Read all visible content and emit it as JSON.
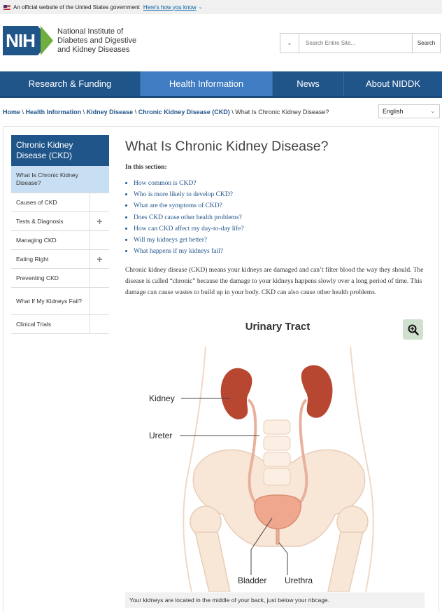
{
  "gov_banner": {
    "text": "An official website of the United States government",
    "link": "Here's how you know"
  },
  "header": {
    "logo_text": "NIH",
    "institute_name": [
      "National Institute of",
      "Diabetes and Digestive",
      "and Kidney Diseases"
    ],
    "search_placeholder": "Search Entire Site...",
    "search_button": "Search"
  },
  "nav": {
    "items": [
      {
        "label": "Research & Funding"
      },
      {
        "label": "Health Information"
      },
      {
        "label": "News"
      },
      {
        "label": "About NIDDK"
      }
    ]
  },
  "breadcrumb": {
    "items": [
      "Home",
      "Health Information",
      "Kidney Disease",
      "Chronic Kidney Disease (CKD)"
    ],
    "current": "What Is Chronic Kidney Disease?",
    "separator": "\\"
  },
  "language": {
    "selected": "English"
  },
  "sidebar": {
    "title": "Chronic Kidney Disease (CKD)",
    "items": [
      {
        "label": "What Is Chronic Kidney Disease?"
      },
      {
        "label": "Causes of CKD"
      },
      {
        "label": "Tests & Diagnosis"
      },
      {
        "label": "Managing CKD"
      },
      {
        "label": "Eating Right"
      },
      {
        "label": "Preventing CKD"
      },
      {
        "label": "What If My Kidneys Fail?"
      },
      {
        "label": "Clinical Trials"
      }
    ],
    "expand_symbol": "+"
  },
  "main": {
    "title": "What Is Chronic Kidney Disease?",
    "section_label": "In this section:",
    "toc": [
      "How common is CKD?",
      "Who is more likely to develop CKD?",
      "What are the symptoms of CKD?",
      "Does CKD cause other health problems?",
      "How can CKD affect my day-to-day life?",
      "Will my kidneys get better?",
      "What happens if my kidneys fail?"
    ],
    "paragraph": "Chronic kidney disease (CKD) means your kidneys are damaged and can’t filter blood the way they should. The disease is called “chronic” because the damage to your kidneys happens slowly over a long period of time. This damage can cause wastes to build up in your body. CKD can also cause other health problems."
  },
  "figure": {
    "title": "Urinary Tract",
    "labels": {
      "kidney": "Kidney",
      "ureter": "Ureter",
      "bladder": "Bladder",
      "urethra": "Urethra"
    },
    "caption": "Your kidneys are located in the middle of your back, just below your ribcage.",
    "zoom_icon": "zoom-in-icon"
  },
  "colors": {
    "brand_blue": "#20558a",
    "active_nav": "#3f7cc2",
    "sidebar_active": "#c8def2",
    "nih_green": "#6fae3f"
  }
}
